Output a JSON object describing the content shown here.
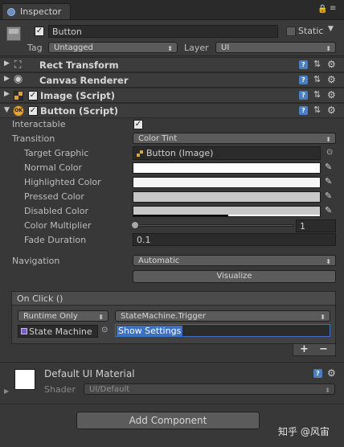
{
  "tab": {
    "title": "Inspector"
  },
  "header": {
    "name": "Button",
    "static_label": "Static",
    "tag_label": "Tag",
    "tag_value": "Untagged",
    "layer_label": "Layer",
    "layer_value": "UI"
  },
  "components": {
    "rect_transform": "Rect Transform",
    "canvas_renderer": "Canvas Renderer",
    "image_script": "Image (Script)",
    "button_script": "Button (Script)"
  },
  "button": {
    "interactable_label": "Interactable",
    "transition_label": "Transition",
    "transition_value": "Color Tint",
    "target_graphic_label": "Target Graphic",
    "target_graphic_value": "Button (Image)",
    "normal_color_label": "Normal Color",
    "highlighted_color_label": "Highlighted Color",
    "pressed_color_label": "Pressed Color",
    "disabled_color_label": "Disabled Color",
    "color_multiplier_label": "Color Multiplier",
    "color_multiplier_value": "1",
    "fade_duration_label": "Fade Duration",
    "fade_duration_value": "0.1",
    "navigation_label": "Navigation",
    "navigation_value": "Automatic",
    "visualize_label": "Visualize"
  },
  "onclick": {
    "title": "On Click ()",
    "runtime_value": "Runtime Only",
    "function_value": "StateMachine.Trigger",
    "object_value": "State Machine",
    "argument_value": "Show Settings",
    "add_label": "+",
    "remove_label": "−"
  },
  "material": {
    "name": "Default UI Material",
    "shader_label": "Shader",
    "shader_value": "UI/Default"
  },
  "footer": {
    "add_component_label": "Add Component",
    "watermark": "知乎 @风宙"
  },
  "colors": {
    "normal": "#ffffff",
    "highlighted": "#f5f5f5",
    "pressed": "#c8c8c8",
    "disabled": "#c8c8c8",
    "selection": "#3d6fc2"
  }
}
